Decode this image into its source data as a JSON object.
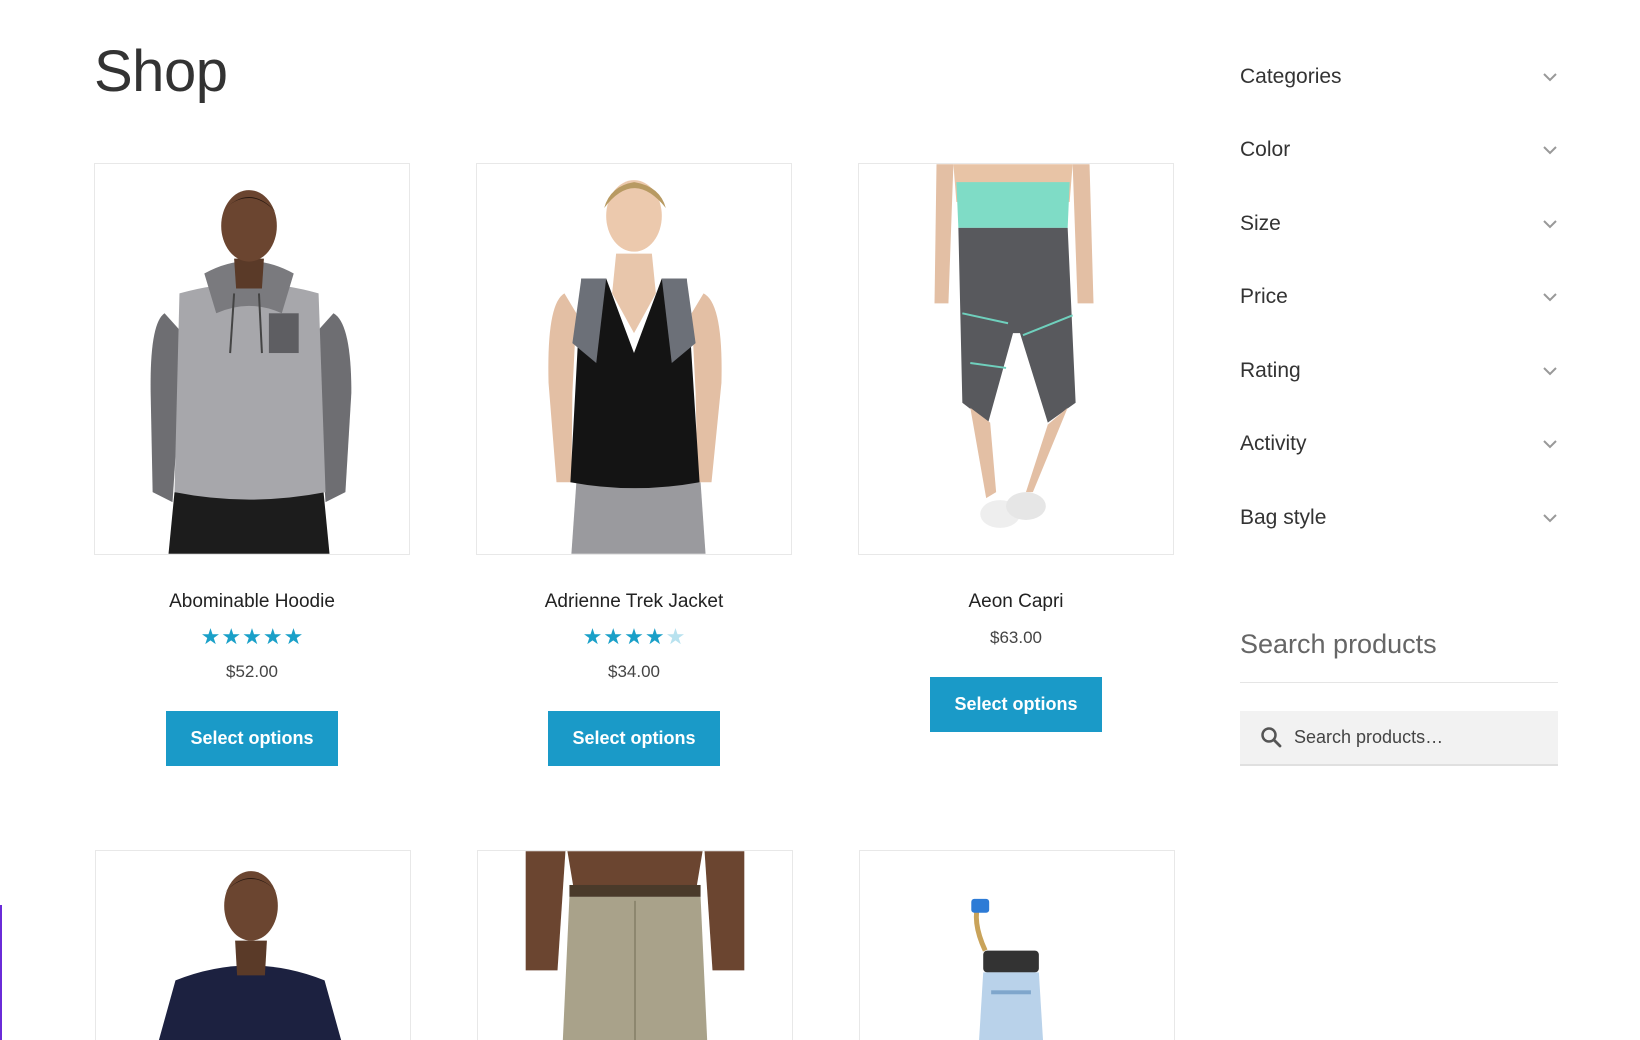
{
  "page": {
    "title": "Shop"
  },
  "products": [
    {
      "name": "Abominable Hoodie",
      "rating": 5,
      "price": "$52.00",
      "button": "Select options"
    },
    {
      "name": "Adrienne Trek Jacket",
      "rating": 4,
      "price": "$34.00",
      "button": "Select options"
    },
    {
      "name": "Aeon Capri",
      "rating": null,
      "price": "$63.00",
      "button": "Select options"
    }
  ],
  "sidebar": {
    "filters": [
      {
        "label": "Categories"
      },
      {
        "label": "Color"
      },
      {
        "label": "Size"
      },
      {
        "label": "Price"
      },
      {
        "label": "Rating"
      },
      {
        "label": "Activity"
      },
      {
        "label": "Bag style"
      }
    ],
    "search": {
      "title": "Search products",
      "placeholder": "Search products…"
    }
  },
  "colors": {
    "accent": "#1a9ac8",
    "star": "#1aa0c8",
    "star_empty": "#b8e2ef"
  }
}
